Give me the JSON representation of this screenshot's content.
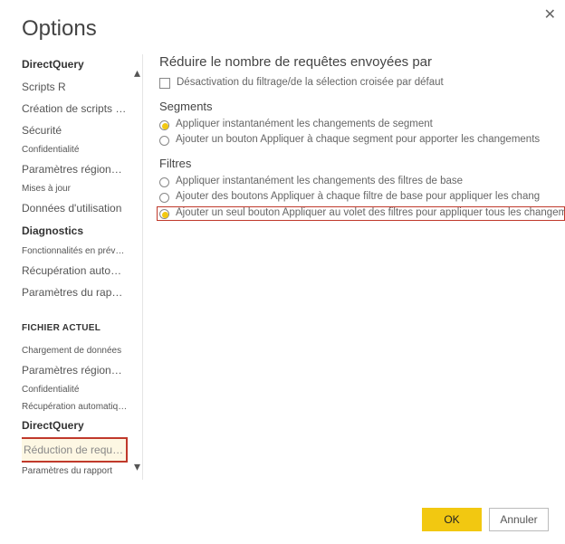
{
  "window": {
    "title": "Options"
  },
  "sidebar": {
    "scroll_up": "▴",
    "scroll_down": "▾",
    "items": [
      {
        "label": "DirectQuery",
        "type": "bold"
      },
      {
        "label": "Scripts R",
        "type": "item"
      },
      {
        "label": "Création de scripts Python",
        "type": "item"
      },
      {
        "label": "Sécurité",
        "type": "item"
      },
      {
        "label": "Confidentialité",
        "type": "small"
      },
      {
        "label": "Paramètres régionaux",
        "type": "item"
      },
      {
        "label": "Mises à jour",
        "type": "small"
      },
      {
        "label": "Données d'utilisation",
        "type": "item"
      },
      {
        "label": "Diagnostics",
        "type": "bold"
      },
      {
        "label": "Fonctionnalités en préversion",
        "type": "small"
      },
      {
        "label": "Récupération automatique",
        "type": "item"
      },
      {
        "label": "Paramètres du rapport",
        "type": "item"
      }
    ],
    "section2_title": "FICHIER ACTUEL",
    "items2": [
      {
        "label": "Chargement de données",
        "type": "small"
      },
      {
        "label": "Paramètres régionaux",
        "type": "item"
      },
      {
        "label": "Confidentialité",
        "type": "small"
      },
      {
        "label": "Récupération automatique",
        "type": "small"
      },
      {
        "label": "DirectQuery",
        "type": "bold"
      },
      {
        "label": "Réduction de requête",
        "type": "selected"
      },
      {
        "label": "Paramètres du rapport",
        "type": "small"
      }
    ]
  },
  "content": {
    "title": "Réduire le nombre de requêtes envoyées par",
    "checkbox1": "Désactivation du filtrage/de la sélection croisée par défaut",
    "sub_segments": "Segments",
    "seg_r1": "Appliquer instantanément les changements de segment",
    "seg_r2": "Ajouter un bouton Appliquer à chaque segment pour apporter les changements",
    "sub_filters": "Filtres",
    "fil_r1": "Appliquer instantanément les changements des filtres de base",
    "fil_r2": "Ajouter des boutons Appliquer à chaque filtre de base pour appliquer les chang",
    "fil_r3": "Ajouter un seul bouton Appliquer au volet des filtres pour appliquer tous les changements"
  },
  "footer": {
    "ok": "OK",
    "cancel": "Annuler"
  }
}
